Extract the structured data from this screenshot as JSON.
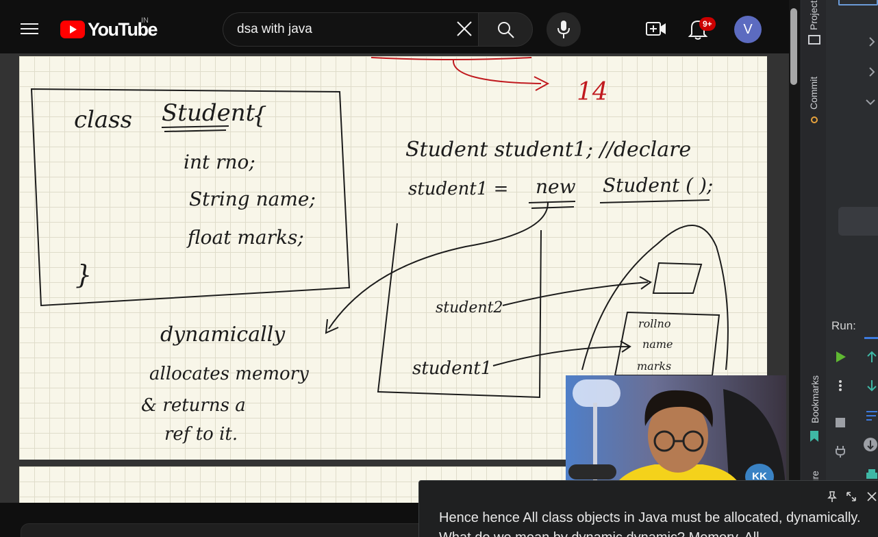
{
  "header": {
    "logo_text": "YouTube",
    "country_code": "IN",
    "search_value": "dsa with java",
    "notification_count": "9+",
    "avatar_letter": "V",
    "brand_color": "#ff0000"
  },
  "note": {
    "class_def": [
      "class",
      "Student",
      "{"
    ],
    "fields": [
      "int rno;",
      "String name;",
      "float marks;"
    ],
    "closing_brace": "}",
    "declare_line": "Student  student1;  //declare",
    "assign_line_left": "student1  =",
    "assign_new": "new",
    "assign_ctor": "Student ( );",
    "red_number": "14",
    "stack_vars": [
      "student2",
      "student1"
    ],
    "heap_fields": [
      "rollno",
      "name",
      "marks"
    ],
    "dynamic_note": [
      "dynamically",
      "allocates memory",
      "& returns a",
      "ref to it."
    ]
  },
  "ide": {
    "tab_project": "Project",
    "tab_commit": "Commit",
    "tab_bookmarks": "Bookmarks",
    "tab_structure": "Structure",
    "run_label": "Run:"
  },
  "caption": {
    "line1": "Hence hence All class objects in Java must be allocated, dynamically.",
    "line2": "What do we mean by dynamic dynamic? Memory. All"
  },
  "webcam": {
    "watermark": "KK"
  }
}
